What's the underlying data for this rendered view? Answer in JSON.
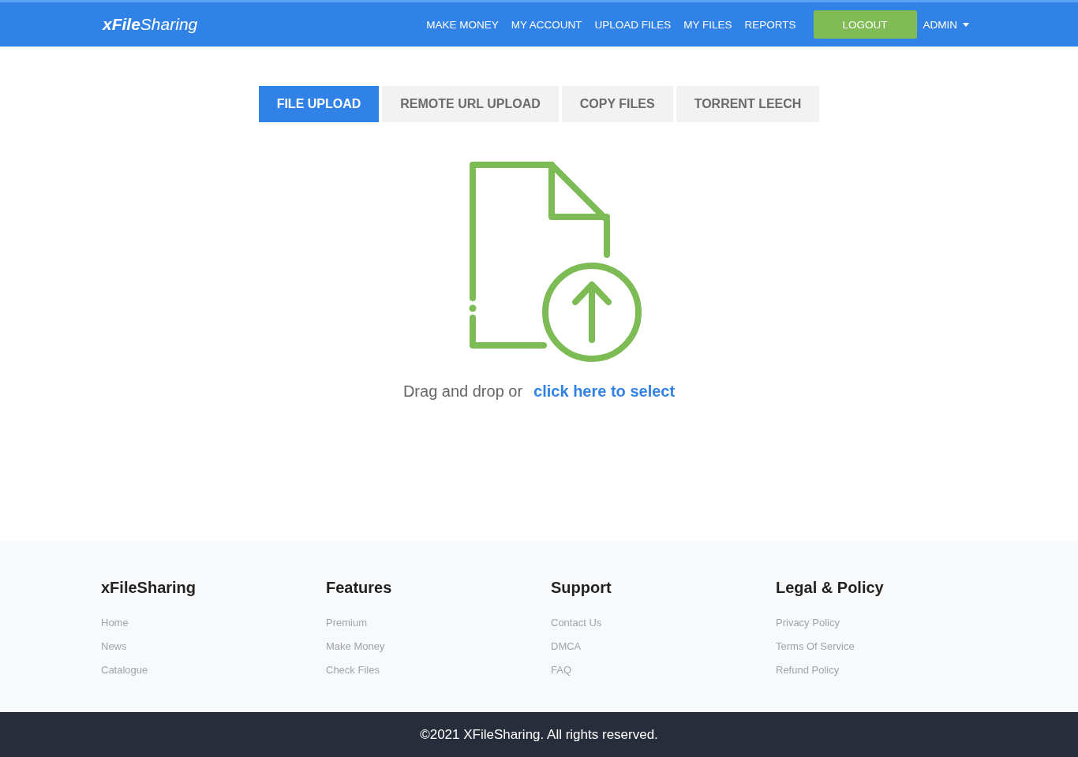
{
  "header": {
    "logo": "**xFile**Sharing",
    "nav": [
      "MAKE MONEY",
      "MY ACCOUNT",
      "UPLOAD FILES",
      "MY FILES",
      "REPORTS"
    ],
    "logout": "LOGOUT",
    "user_menu": "ADMIN"
  },
  "tabs": [
    {
      "label": "FILE UPLOAD",
      "selected": true
    },
    {
      "label": "REMOTE URL UPLOAD",
      "selected": false
    },
    {
      "label": "COPY FILES",
      "selected": false
    },
    {
      "label": "TORRENT LEECH",
      "selected": false
    }
  ],
  "dropzone": {
    "text": "Drag and drop or",
    "link": "click here to select"
  },
  "footer": {
    "columns": [
      {
        "title": "xFileSharing",
        "links": [
          "Home",
          "News",
          "Catalogue"
        ]
      },
      {
        "title": "Features",
        "links": [
          "Premium",
          "Make Money",
          "Check Files"
        ]
      },
      {
        "title": "Support",
        "links": [
          "Contact Us",
          "DMCA",
          "FAQ"
        ]
      },
      {
        "title": "Legal & Policy",
        "links": [
          "Privacy Policy",
          "Terms Of Service",
          "Refund Policy"
        ]
      }
    ],
    "copyright": "©2021 XFileSharing. All rights reserved."
  }
}
